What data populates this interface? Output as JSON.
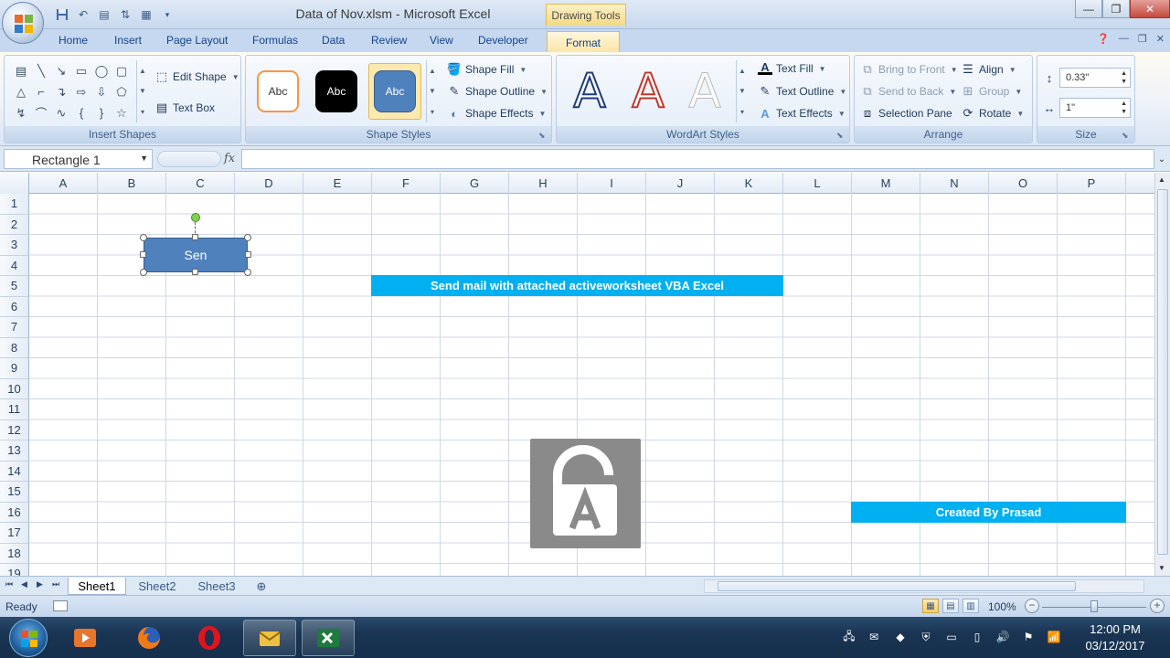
{
  "window": {
    "title": "Data of Nov.xlsm - Microsoft Excel",
    "context_tab_title": "Drawing Tools"
  },
  "ribbon_tabs": [
    {
      "label": "Home"
    },
    {
      "label": "Insert"
    },
    {
      "label": "Page Layout"
    },
    {
      "label": "Formulas"
    },
    {
      "label": "Data"
    },
    {
      "label": "Review"
    },
    {
      "label": "View"
    },
    {
      "label": "Developer"
    },
    {
      "label": "Format",
      "active": true
    }
  ],
  "groups": {
    "insert_shapes": {
      "label": "Insert Shapes",
      "edit_shape": "Edit Shape",
      "text_box": "Text Box"
    },
    "shape_styles": {
      "label": "Shape Styles",
      "swatches": [
        "Abc",
        "Abc",
        "Abc"
      ],
      "shape_fill": "Shape Fill",
      "shape_outline": "Shape Outline",
      "shape_effects": "Shape Effects"
    },
    "wordart_styles": {
      "label": "WordArt Styles",
      "letters": [
        "A",
        "A",
        "A"
      ],
      "text_fill": "Text Fill",
      "text_outline": "Text Outline",
      "text_effects": "Text Effects"
    },
    "arrange": {
      "label": "Arrange",
      "bring_to_front": "Bring to Front",
      "send_to_back": "Send to Back",
      "selection_pane": "Selection Pane",
      "align": "Align",
      "group": "Group",
      "rotate": "Rotate"
    },
    "size": {
      "label": "Size",
      "height": "0.33\"",
      "width": "1\""
    }
  },
  "formula_bar": {
    "name_box": "Rectangle 1",
    "fx": "fx",
    "value": ""
  },
  "grid": {
    "columns": [
      "A",
      "B",
      "C",
      "D",
      "E",
      "F",
      "G",
      "H",
      "I",
      "J",
      "K",
      "L",
      "M",
      "N",
      "O",
      "P"
    ],
    "rows": [
      "1",
      "2",
      "3",
      "4",
      "5",
      "6",
      "7",
      "8",
      "9",
      "10",
      "11",
      "12",
      "13",
      "14",
      "15",
      "16",
      "17",
      "18",
      "19"
    ]
  },
  "shapes": {
    "rectangle_text": "Sen",
    "banner_title": "Send mail with attached activeworksheet VBA Excel",
    "banner_credit": "Created By Prasad"
  },
  "sheet_tabs": [
    "Sheet1",
    "Sheet2",
    "Sheet3"
  ],
  "active_sheet": "Sheet1",
  "status": {
    "text": "Ready",
    "zoom": "100%"
  },
  "taskbar": {
    "time": "12:00 PM",
    "date": "03/12/2017"
  },
  "colors": {
    "accent_banner": "#00b0f0",
    "shape_fill": "#4f81bd",
    "format_tab": "#fbe4a5"
  }
}
